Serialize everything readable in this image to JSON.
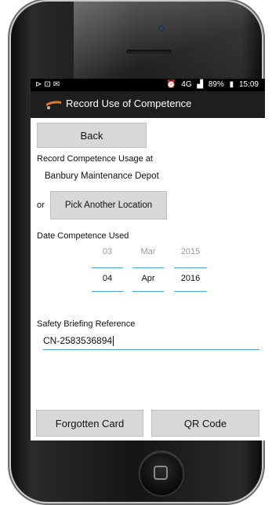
{
  "status_bar": {
    "left_icons": [
      "notification-icon",
      "image-icon",
      "mail-icon"
    ],
    "alarm_icon": "alarm-icon",
    "network": "4G",
    "signal_icon": "signal-icon",
    "battery": "89%",
    "battery_icon": "battery-icon",
    "time": "15:09"
  },
  "action_bar": {
    "title": "Record Use of Competence",
    "logo_icon": "app-logo-icon",
    "background": "#1e1e1e"
  },
  "buttons": {
    "back": "Back",
    "pick_location": "Pick Another Location",
    "forgotten_card": "Forgotten Card",
    "qr_code": "QR Code"
  },
  "location": {
    "prompt": "Record Competence Usage at",
    "name": "Banbury Maintenance Depot",
    "or": "or"
  },
  "date_picker": {
    "label": "Date Competence Used",
    "previous": {
      "day": "03",
      "month": "Mar",
      "year": "2015"
    },
    "selected": {
      "day": "04",
      "month": "Apr",
      "year": "2016"
    },
    "accent": "#4aa3df"
  },
  "safety": {
    "label": "Safety Briefing Reference",
    "value": "CN-2583536894"
  }
}
